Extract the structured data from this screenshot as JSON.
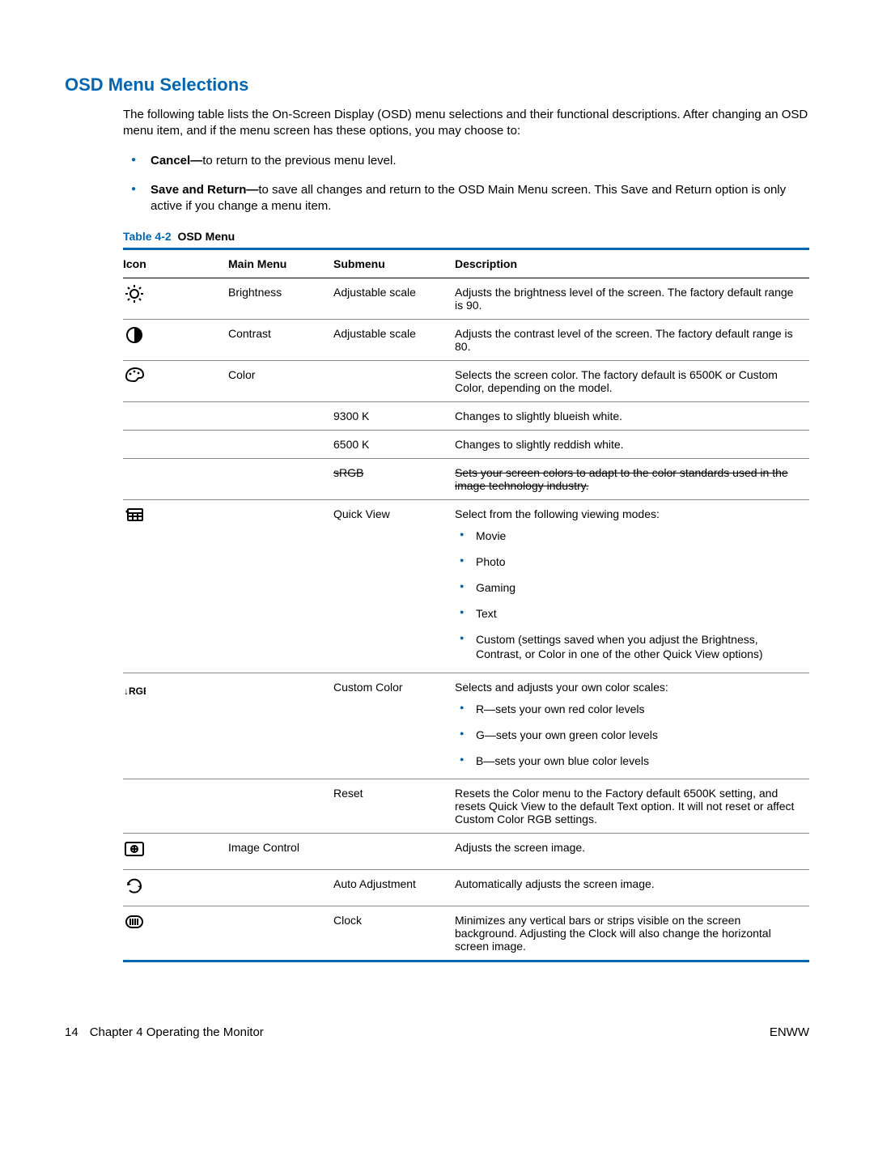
{
  "heading": "OSD Menu Selections",
  "intro": "The following table lists the On-Screen Display (OSD) menu selections and their functional descriptions. After changing an OSD menu item, and if the menu screen has these options, you may choose to:",
  "topBullets": [
    {
      "bold": "Cancel—",
      "rest": "to return to the previous menu level."
    },
    {
      "bold": "Save and Return—",
      "rest": "to save all changes and return to the OSD Main Menu screen. This Save and Return option is only active if you change a menu item."
    }
  ],
  "tableCaption": {
    "num": "Table 4-2",
    "title": "OSD Menu"
  },
  "columns": {
    "icon": "Icon",
    "main": "Main Menu",
    "sub": "Submenu",
    "desc": "Description"
  },
  "rows": [
    {
      "icon": "brightness",
      "main": "Brightness",
      "sub": "Adjustable scale",
      "desc": "Adjusts the brightness level of the screen. The factory default range is 90."
    },
    {
      "icon": "contrast",
      "main": "Contrast",
      "sub": "Adjustable scale",
      "desc": "Adjusts the contrast level of the screen. The factory default range is 80."
    },
    {
      "icon": "color",
      "main": "Color",
      "sub": "",
      "desc": "Selects the screen color. The factory default is 6500K or Custom Color, depending on the model."
    },
    {
      "icon": "",
      "main": "",
      "sub": "9300 K",
      "desc": "Changes to slightly blueish white."
    },
    {
      "icon": "",
      "main": "",
      "sub": "6500 K",
      "desc": "Changes to slightly reddish white."
    },
    {
      "icon": "",
      "main": "",
      "sub": "sRGB",
      "subStrike": true,
      "desc": "Sets your screen colors to adapt to the color standards used in the image technology industry.",
      "descStrike": true
    },
    {
      "icon": "quickview",
      "main": "",
      "sub": "Quick View",
      "desc": "Select from the following viewing modes:",
      "bullets": [
        "Movie",
        "Photo",
        "Gaming",
        "Text",
        "Custom (settings saved when you adjust the Brightness, Contrast, or Color in one of the other Quick View options)"
      ]
    },
    {
      "icon": "rgb",
      "main": "",
      "sub": "Custom Color",
      "desc": "Selects and adjusts your own color scales:",
      "bullets": [
        "R—sets your own red color levels",
        "G—sets your own green color levels",
        "B—sets your own blue color levels"
      ]
    },
    {
      "icon": "",
      "main": "",
      "sub": "Reset",
      "desc": "Resets the Color menu to the Factory default 6500K setting, and resets Quick View to the default Text option. It will not reset or affect Custom Color RGB settings."
    },
    {
      "icon": "imagecontrol",
      "main": "Image Control",
      "sub": "",
      "desc": "Adjusts the screen image."
    },
    {
      "icon": "auto",
      "main": "",
      "sub": "Auto Adjustment",
      "desc": "Automatically adjusts the screen image."
    },
    {
      "icon": "clock",
      "main": "",
      "sub": "Clock",
      "desc": "Minimizes any vertical bars or strips visible on the screen background. Adjusting the Clock will also change the horizontal screen image.",
      "last": true
    }
  ],
  "footer": {
    "page": "14",
    "chapter": "Chapter 4   Operating the Monitor",
    "right": "ENWW"
  }
}
